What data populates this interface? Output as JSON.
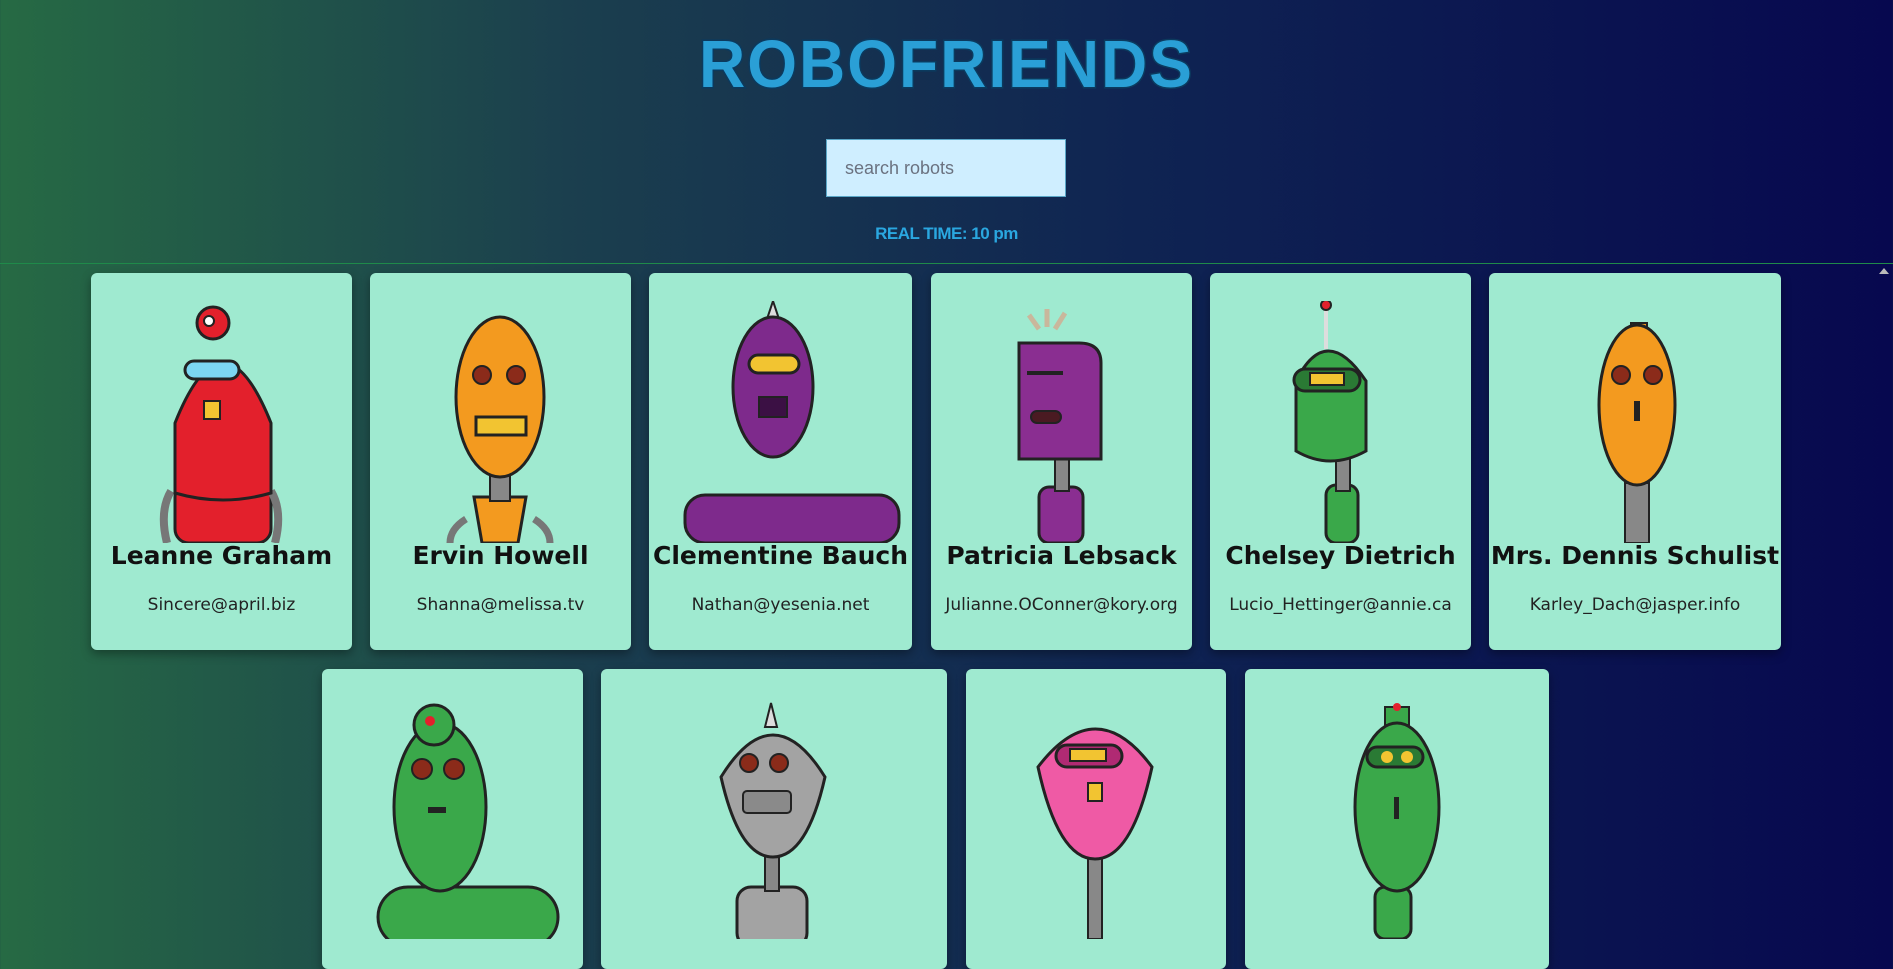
{
  "app": {
    "title": "ROBOFRIENDS",
    "search": {
      "placeholder": "search robots",
      "value": ""
    },
    "realtime": "REAL TIME: 10 pm"
  },
  "robots": [
    {
      "name": "Leanne Graham",
      "email": "Sincere@april.biz",
      "color": "#e3202c"
    },
    {
      "name": "Ervin Howell",
      "email": "Shanna@melissa.tv",
      "color": "#f39a1f"
    },
    {
      "name": "Clementine Bauch",
      "email": "Nathan@yesenia.net",
      "color": "#7e2a8c"
    },
    {
      "name": "Patricia Lebsack",
      "email": "Julianne.OConner@kory.org",
      "color": "#8a2e91"
    },
    {
      "name": "Chelsey Dietrich",
      "email": "Lucio_Hettinger@annie.ca",
      "color": "#3aa84a"
    },
    {
      "name": "Mrs. Dennis Schulist",
      "email": "Karley_Dach@jasper.info",
      "color": "#f39a1f"
    },
    {
      "name": "",
      "email": "",
      "color": "#3aa84a"
    },
    {
      "name": "",
      "email": "",
      "color": "#a3a3a3"
    },
    {
      "name": "",
      "email": "",
      "color": "#ef5aa5"
    },
    {
      "name": "",
      "email": "",
      "color": "#3aa84a"
    }
  ]
}
